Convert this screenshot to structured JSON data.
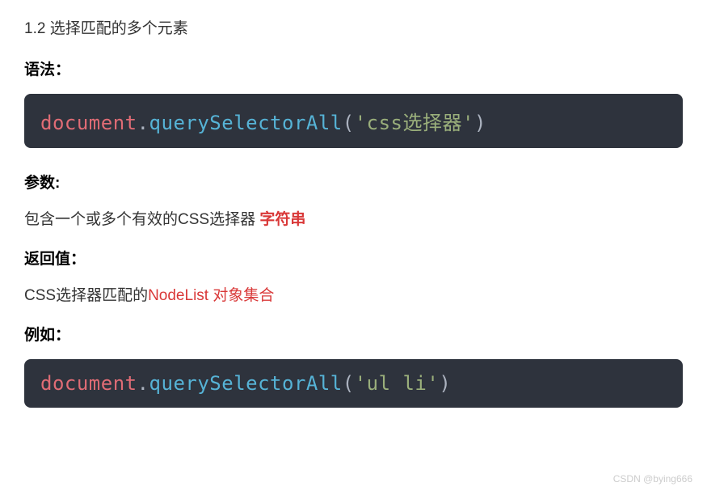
{
  "section_title": "1.2 选择匹配的多个元素",
  "syntax_label": "语法：",
  "code1": {
    "document": "document",
    "dot": ".",
    "method": "querySelectorAll",
    "open": "(",
    "arg": "'css选择器'",
    "close": ")"
  },
  "params_label": "参数:",
  "params_text_prefix": "包含一个或多个有效的CSS选择器 ",
  "params_text_highlight": "字符串",
  "return_label": "返回值：",
  "return_prefix": "CSS选择器匹配的",
  "return_highlight": "NodeList  对象集合",
  "example_label": "例如：",
  "code2": {
    "document": "document",
    "dot": ".",
    "method": "querySelectorAll",
    "open": "(",
    "arg": "'ul li'",
    "close": ")"
  },
  "watermark": "CSDN @bying666"
}
